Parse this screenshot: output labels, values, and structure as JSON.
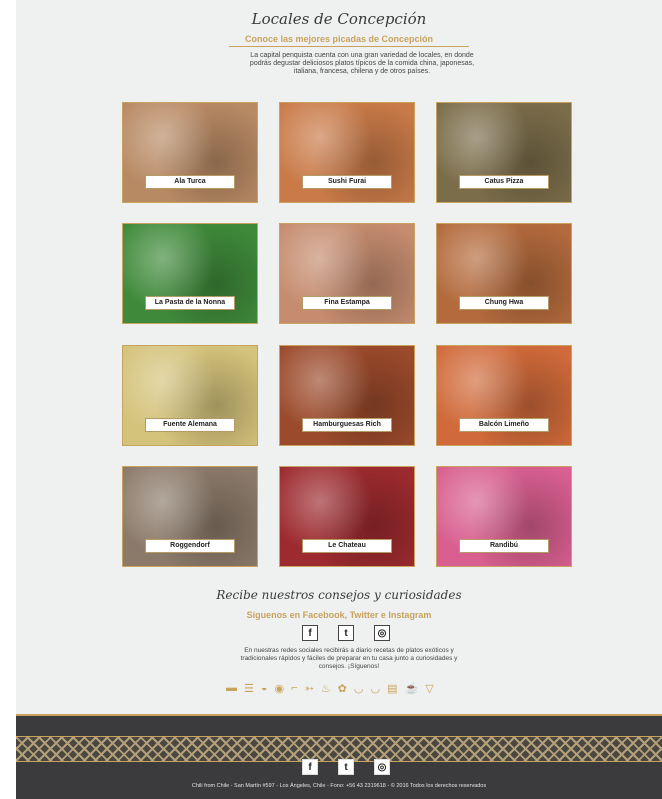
{
  "header": {
    "title": "Locales de Concepción",
    "subtitle": "Conoce las mejores picadas de Concepción",
    "intro": "La capital penquista cuenta con una gran variedad de locales, en donde podrás degustar deliciosos platos típicos de la comida china, japonesas, italiana, francesa, chilena y de otros países."
  },
  "restaurants": [
    {
      "name": "Ala Turca",
      "tint": "#b88a64"
    },
    {
      "name": "Sushi Furai",
      "tint": "#c97a48"
    },
    {
      "name": "Catus Pizza",
      "tint": "#7b6d4a"
    },
    {
      "name": "La Pasta de la Nonna",
      "tint": "#3f8a3a"
    },
    {
      "name": "Fina Estampa",
      "tint": "#c58c6f"
    },
    {
      "name": "Chung Hwa",
      "tint": "#b36a3c"
    },
    {
      "name": "Fuente Alemana",
      "tint": "#d4c37b"
    },
    {
      "name": "Hamburguesas Rich",
      "tint": "#9b4a2b"
    },
    {
      "name": "Balcón Limeño",
      "tint": "#d06a3a"
    },
    {
      "name": "Roggendorf",
      "tint": "#8b7a6a"
    },
    {
      "name": "Le Chateau",
      "tint": "#9c2a2e"
    },
    {
      "name": "Randibú",
      "tint": "#d85f8f"
    }
  ],
  "social": {
    "title": "Recibe nuestros consejos y curiosidades",
    "subtitle": "Síguenos en Facebook, Twitter e Instagram",
    "text": "En nuestras redes sociales recibirás a diario recetas de platos exóticos y tradicionales rápidos y fáciles de preparar en tu casa junto a curiosidades y consejos. ¡Síguenos!",
    "facebook": "f",
    "twitter": "t",
    "instagram": "◎"
  },
  "food_icons": [
    "▬",
    "☰",
    "◒",
    "◉",
    "⌐",
    "➳",
    "♨",
    "✿",
    "◡",
    "◡",
    "▤",
    "☕",
    "▽"
  ],
  "footer": {
    "copyright": "Chili from Chile - San Martín #597 - Los Ángeles, Chile - Fono: +56 43 2319618 - © 2016 Todos los derechos reservados"
  }
}
